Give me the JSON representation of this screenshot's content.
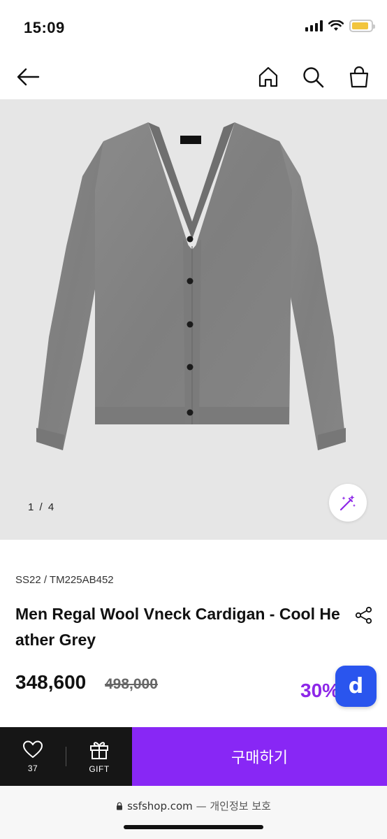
{
  "status_bar": {
    "time": "15:09",
    "battery_level": 0.9,
    "battery_color": "#f2c53d"
  },
  "nav": {
    "back_icon": "back-arrow-icon",
    "home_icon": "home-icon",
    "search_icon": "search-icon",
    "cart_icon": "shopping-bag-icon"
  },
  "gallery": {
    "counter": "1 / 4",
    "current_index": 1,
    "total": 4,
    "magic_icon": "magic-wand-icon",
    "product_image": "grey v-neck cardigan"
  },
  "product": {
    "code": "SS22 / TM225AB452",
    "name": "Men Regal Wool Vneck Cardigan - Cool Heather Grey",
    "price": "348,600",
    "original_price": "498,000",
    "discount": "30%",
    "share_icon": "share-icon",
    "floating_badge": "d"
  },
  "bottom_bar": {
    "like_count": "37",
    "gift_label": "GIFT",
    "buy_label": "구매하기",
    "accent_color": "#8827f5"
  },
  "browser": {
    "domain": "ssfshop.com",
    "suffix": "— 개인정보 보호"
  }
}
